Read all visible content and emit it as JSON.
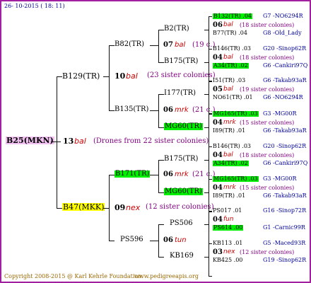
{
  "header": {
    "date": "26- 10-2015 ( 18: 11)"
  },
  "footer": {
    "copyright": "Copyright 2008-2015 @ Karl Kehrle Foundation.",
    "site": "www.pedigreeapis.org"
  },
  "colors": {
    "green": "#00ee00",
    "yellow": "#ffff00",
    "pink": "#f0c0f0",
    "red": "#cc0000",
    "purple": "#800080",
    "blue": "#000099"
  },
  "root": {
    "name": "B25(MKN)",
    "gen": "13",
    "race": "bal",
    "note": "(Drones from 22 sister colonies)"
  },
  "l1": [
    {
      "name": "B129(TR)",
      "gen": "10",
      "race": "bal",
      "note": "(23 sister colonies)"
    },
    {
      "name": "B47(MKK)",
      "gen": "09",
      "race": "nex",
      "note": "(12 sister colonies)"
    }
  ],
  "l2": [
    {
      "name": "B82(TR)",
      "gen": "07",
      "race": "bal",
      "note": "(19 c.)"
    },
    {
      "name": "B135(TR)",
      "gen": "06",
      "race": "mrk",
      "note": "(21 c.)"
    },
    {
      "name": "B171(TR)",
      "gen": "06",
      "race": "mrk",
      "note": "(21 c.)"
    },
    {
      "name": "PS596",
      "gen": "06",
      "race": "tun",
      "note": ""
    }
  ],
  "l3": [
    "B2(TR)",
    "B175(TR)",
    "I177(TR)",
    "MG60(TR)",
    "B175(TR)",
    "MG60(TR)",
    "PS506",
    "KB169"
  ],
  "l4": [
    {
      "a": "B132(TR) .04",
      "b": "G7 -NO6294R",
      "gen": "06",
      "race": "bal",
      "note": "(18 sister colonies)",
      "c": "B77(TR) .04",
      "d": "G8 -Old_Lady"
    },
    {
      "a": "B146(TR) .03",
      "b": "G20 -Sinop62R",
      "gen": "04",
      "race": "bal",
      "note": "(18 sister colonies)",
      "c": "A34(TR) .02",
      "d": "G6 -Cankiri97Q"
    },
    {
      "a": "I51(TR) .03",
      "b": "G6 -Takab93aR",
      "gen": "05",
      "race": "bal",
      "note": "(19 sister colonies)",
      "c": "NO61(TR) .01",
      "d": "G6 -NO6294R"
    },
    {
      "a": "MG165(TR) .03",
      "b": "G3 -MG00R",
      "gen": "04",
      "race": "mrk",
      "note": "(15 sister colonies)",
      "c": "I89(TR) .01",
      "d": "G6 -Takab93aR"
    },
    {
      "a": "B146(TR) .03",
      "b": "G20 -Sinop62R",
      "gen": "04",
      "race": "bal",
      "note": "(18 sister colonies)",
      "c": "A34(TR) .02",
      "d": "G6 -Cankiri97Q"
    },
    {
      "a": "MG165(TR) .03",
      "b": "G3 -MG00R",
      "gen": "04",
      "race": "mrk",
      "note": "(15 sister colonies)",
      "c": "I89(TR) .01",
      "d": "G6 -Takab93aR"
    },
    {
      "a": "PS017 .01",
      "b": "G16 -Sinop72R",
      "gen": "04",
      "race": "fun",
      "note": "",
      "c": "PS614 .00",
      "d": "G1 -Carnic99R"
    },
    {
      "a": "KB113 .01",
      "b": "G5 -Maced93R",
      "gen": "03",
      "race": "nex",
      "note": "(12 sister colonies)",
      "c": "KB425 .00",
      "d": "G19 -Sinop62R"
    }
  ]
}
